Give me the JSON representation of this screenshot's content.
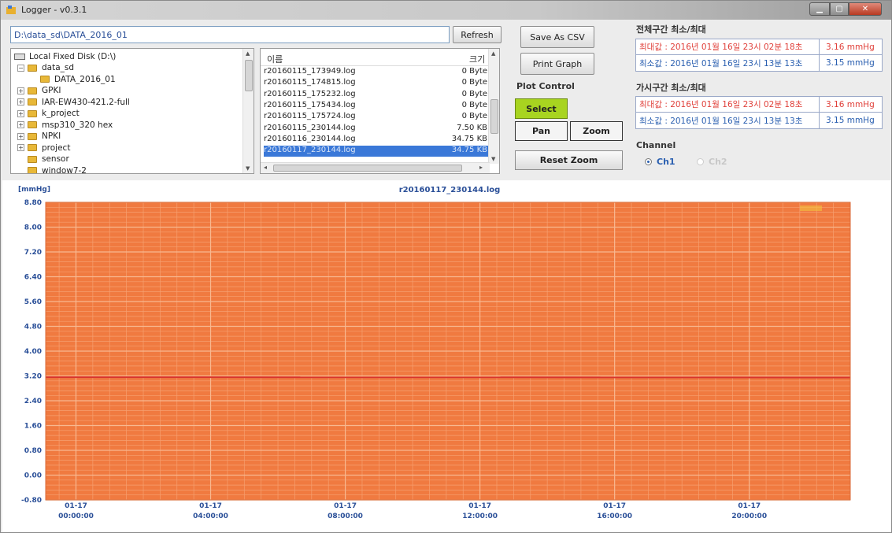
{
  "window": {
    "title": "Logger - v0.3.1"
  },
  "path": {
    "value": "D:\\data_sd\\DATA_2016_01"
  },
  "buttons": {
    "refresh": "Refresh",
    "save_csv": "Save As CSV",
    "print_graph": "Print Graph",
    "select": "Select",
    "pan": "Pan",
    "zoom": "Zoom",
    "reset_zoom": "Reset Zoom"
  },
  "tree": {
    "root": "Local Fixed Disk (D:\\)",
    "items": [
      {
        "label": "data_sd",
        "expander": "⊟",
        "depth": 0
      },
      {
        "label": "DATA_2016_01",
        "expander": "",
        "depth": 1
      },
      {
        "label": "GPKI",
        "expander": "⊞",
        "depth": 0
      },
      {
        "label": "IAR-EW430-421.2-full",
        "expander": "⊞",
        "depth": 0
      },
      {
        "label": "k_project",
        "expander": "⊞",
        "depth": 0
      },
      {
        "label": "msp310_320 hex",
        "expander": "⊞",
        "depth": 0
      },
      {
        "label": "NPKI",
        "expander": "⊞",
        "depth": 0
      },
      {
        "label": "project",
        "expander": "⊞",
        "depth": 0
      },
      {
        "label": "sensor",
        "expander": "",
        "depth": 0
      },
      {
        "label": "window7-2",
        "expander": "",
        "depth": 0
      }
    ]
  },
  "file_list": {
    "header_name": "이름",
    "header_size": "크기",
    "rows": [
      {
        "name": "r20160115_173949.log",
        "size": "0 Byte",
        "selected": false
      },
      {
        "name": "r20160115_174815.log",
        "size": "0 Byte",
        "selected": false
      },
      {
        "name": "r20160115_175232.log",
        "size": "0 Byte",
        "selected": false
      },
      {
        "name": "r20160115_175434.log",
        "size": "0 Byte",
        "selected": false
      },
      {
        "name": "r20160115_175724.log",
        "size": "0 Byte",
        "selected": false
      },
      {
        "name": "r20160115_230144.log",
        "size": "7.50 KB",
        "selected": false
      },
      {
        "name": "r20160116_230144.log",
        "size": "34.75 KB",
        "selected": false
      },
      {
        "name": "r20160117_230144.log",
        "size": "34.75 KB",
        "selected": true
      }
    ]
  },
  "plot_control": {
    "label": "Plot Control"
  },
  "full_range": {
    "title": "전체구간 최소/최대",
    "max_label": "최대값 : 2016년 01월 16일 23시 02분 18초",
    "max_value": "3.16 mmHg",
    "min_label": "최소값 : 2016년 01월 16일 23시 13분 13초",
    "min_value": "3.15 mmHg"
  },
  "visible_range": {
    "title": "가시구간 최소/최대",
    "max_label": "최대값 : 2016년 01월 16일 23시 02분 18초",
    "max_value": "3.16 mmHg",
    "min_label": "최소값 : 2016년 01월 16일 23시 13분 13초",
    "min_value": "3.15 mmHg"
  },
  "channel": {
    "label": "Channel",
    "options": [
      {
        "label": "Ch1",
        "checked": true,
        "enabled": true
      },
      {
        "label": "Ch2",
        "checked": false,
        "enabled": false
      }
    ]
  },
  "colors": {
    "plot_bg": "#f07a40",
    "grid": "#f6a070",
    "series": "#d8342c",
    "axis_text": "#2a4f98",
    "title_text": "#2a4f98"
  },
  "chart_data": {
    "type": "line",
    "title": "r20160117_230144.log",
    "ylabel": "[mmHg]",
    "ylim": [
      -0.8,
      8.8
    ],
    "yticks": [
      "8.80",
      "8.00",
      "7.20",
      "6.40",
      "5.60",
      "4.80",
      "4.00",
      "3.20",
      "2.40",
      "1.60",
      "0.80",
      "0.00",
      "-0.80"
    ],
    "ytick_values": [
      8.8,
      8.0,
      7.2,
      6.4,
      5.6,
      4.8,
      4.0,
      3.2,
      2.4,
      1.6,
      0.8,
      0.0,
      -0.8
    ],
    "xticks": [
      {
        "date": "01-17",
        "time": "00:00:00",
        "hour": 0
      },
      {
        "date": "01-17",
        "time": "04:00:00",
        "hour": 4
      },
      {
        "date": "01-17",
        "time": "08:00:00",
        "hour": 8
      },
      {
        "date": "01-17",
        "time": "12:00:00",
        "hour": 12
      },
      {
        "date": "01-17",
        "time": "16:00:00",
        "hour": 16
      },
      {
        "date": "01-17",
        "time": "20:00:00",
        "hour": 20
      }
    ],
    "xlim_hours": [
      -0.9,
      23.0
    ],
    "series": [
      {
        "legend_mark": "",
        "x_hours": [
          -0.9,
          23.0
        ],
        "y": [
          3.16,
          3.15
        ]
      }
    ],
    "grid": true
  }
}
